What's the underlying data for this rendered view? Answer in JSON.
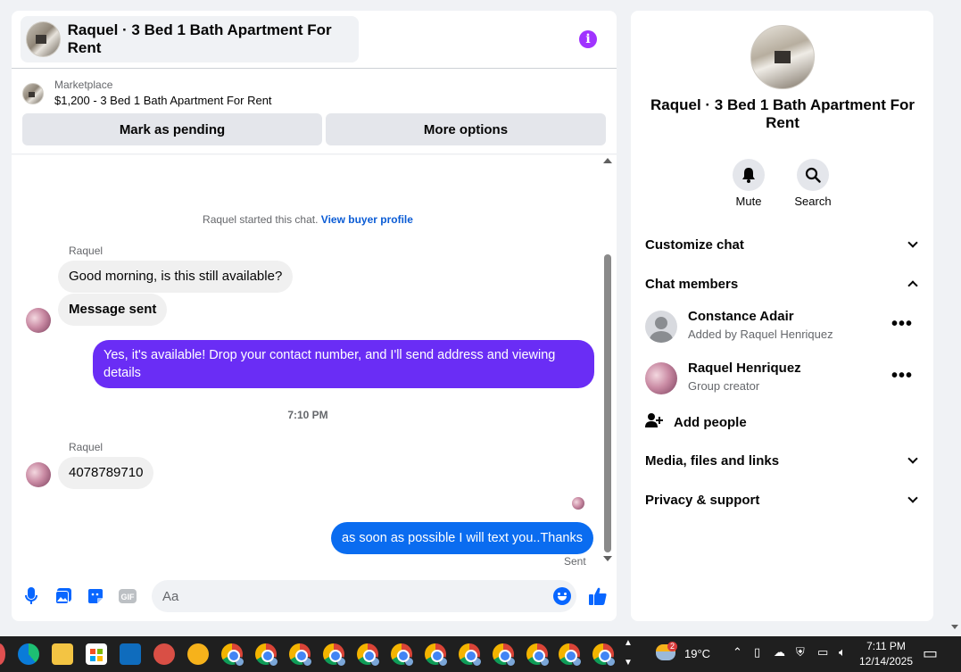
{
  "chat": {
    "title": "Raquel · 3 Bed 1 Bath Apartment For Rent",
    "marketplace_label": "Marketplace",
    "listing": "$1,200 - 3 Bed 1 Bath Apartment For Rent",
    "btn_pending": "Mark as pending",
    "btn_more": "More options",
    "system_text": "Raquel started this chat.",
    "system_link": "View buyer profile",
    "messages": [
      {
        "sender": "Raquel",
        "text": "Good morning, is this still available?"
      },
      {
        "text": "Message sent"
      },
      {
        "text": "Yes, it's available! Drop your contact number, and I'll send address and viewing details"
      },
      {
        "time": "7:10 PM"
      },
      {
        "sender": "Raquel",
        "text": "4078789710"
      },
      {
        "text": "as soon as possible I will text you..Thanks"
      }
    ],
    "sent_status": "Sent",
    "composer_placeholder": "Aa"
  },
  "side": {
    "title": "Raquel · 3 Bed 1 Bath Apartment For Rent",
    "mute_label": "Mute",
    "search_label": "Search",
    "customize": "Customize chat",
    "members_header": "Chat members",
    "members": [
      {
        "name": "Constance Adair",
        "sub": "Added by Raquel Henriquez"
      },
      {
        "name": "Raquel Henriquez",
        "sub": "Group creator"
      }
    ],
    "add_people": "Add people",
    "media": "Media, files and links",
    "privacy": "Privacy & support"
  },
  "taskbar": {
    "temperature": "19°C",
    "weather_badge": "2",
    "time": "7:11 PM",
    "date": "12/14/2025"
  },
  "colors": {
    "accent": "#0866ff",
    "purple_bubble": "#6a2df5",
    "blue_bubble": "#0a6cf0",
    "info": "#a033ff"
  }
}
